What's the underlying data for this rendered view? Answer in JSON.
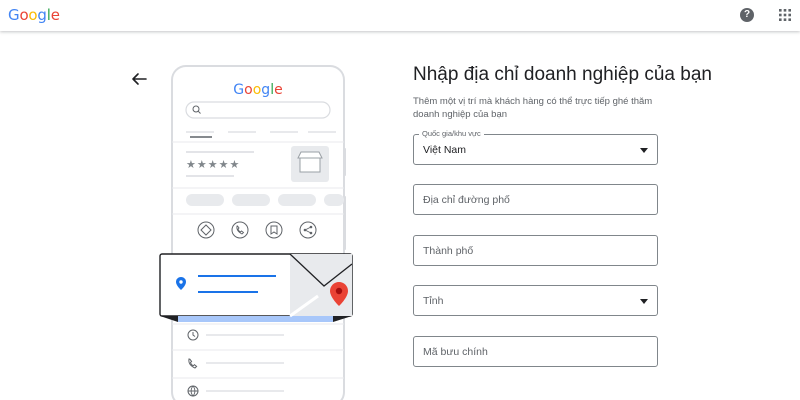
{
  "header": {
    "logo_letters": [
      {
        "ch": "G",
        "color": "#4285F4"
      },
      {
        "ch": "o",
        "color": "#EA4335"
      },
      {
        "ch": "o",
        "color": "#FBBC05"
      },
      {
        "ch": "g",
        "color": "#4285F4"
      },
      {
        "ch": "l",
        "color": "#34A853"
      },
      {
        "ch": "e",
        "color": "#EA4335"
      }
    ],
    "help_glyph": "?",
    "icons": [
      "help-icon",
      "apps-grid-icon"
    ]
  },
  "illustration": {
    "logo_letters": [
      {
        "ch": "G",
        "color": "#4285F4"
      },
      {
        "ch": "o",
        "color": "#EA4335"
      },
      {
        "ch": "o",
        "color": "#FBBC05"
      },
      {
        "ch": "g",
        "color": "#4285F4"
      },
      {
        "ch": "l",
        "color": "#34A853"
      },
      {
        "ch": "e",
        "color": "#EA4335"
      }
    ],
    "stars": "★★★★★",
    "icons": [
      "search-icon",
      "directions-icon",
      "phone-icon",
      "bookmark-icon",
      "share-icon",
      "store-icon",
      "location-pin-icon",
      "map-pin-icon",
      "clock-icon",
      "phone-icon",
      "globe-icon"
    ]
  },
  "form": {
    "title": "Nhập địa chỉ doanh nghiệp của bạn",
    "subtitle": "Thêm một vị trí mà khách hàng có thể trực tiếp ghé thăm doanh nghiệp của bạn",
    "country": {
      "label": "Quốc gia/khu vực",
      "value": "Việt Nam"
    },
    "street": {
      "placeholder": "Địa chỉ đường phố"
    },
    "city": {
      "placeholder": "Thành phố"
    },
    "province": {
      "placeholder": "Tỉnh"
    },
    "postal": {
      "placeholder": "Mã bưu chính"
    }
  },
  "colors": {
    "blue": "#4285F4",
    "red": "#EA4335",
    "border": "#80868b",
    "text_secondary": "#5f6368"
  }
}
